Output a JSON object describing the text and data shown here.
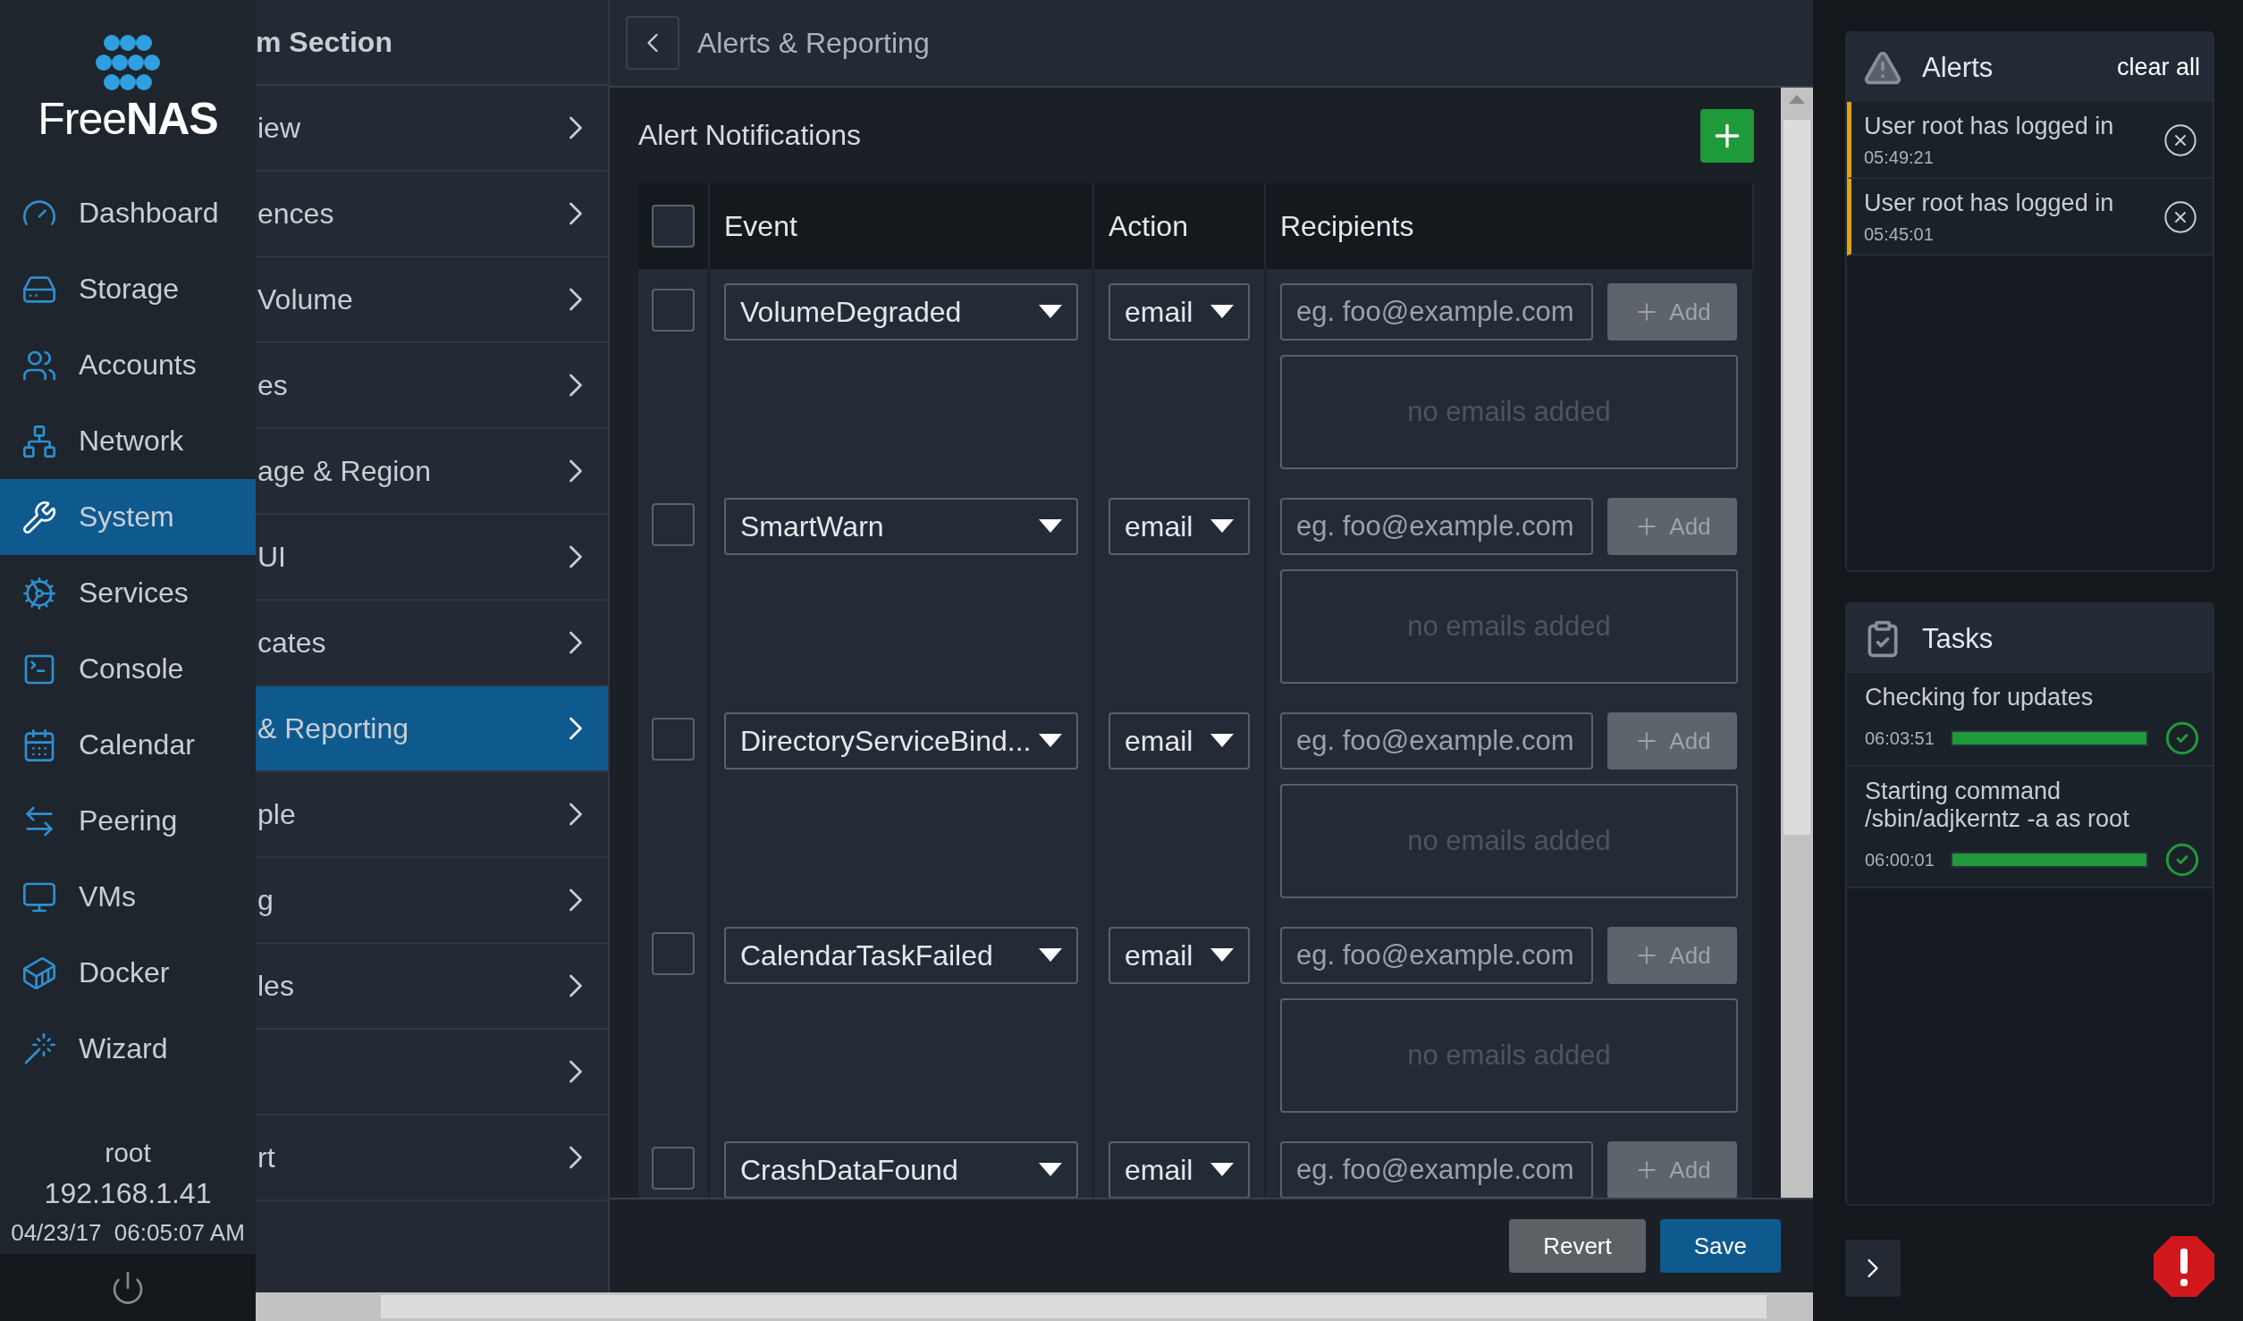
{
  "sidebar": {
    "logo": "Free**NAS**",
    "items": [
      {
        "label": "Dashboard",
        "selected": false
      },
      {
        "label": "Storage",
        "selected": false
      },
      {
        "label": "Accounts",
        "selected": false
      },
      {
        "label": "Network",
        "selected": false
      },
      {
        "label": "System",
        "selected": true
      },
      {
        "label": "Services",
        "selected": false
      },
      {
        "label": "Console",
        "selected": false
      },
      {
        "label": "Calendar",
        "selected": false
      },
      {
        "label": "Peering",
        "selected": false
      },
      {
        "label": "VMs",
        "selected": false
      },
      {
        "label": "Docker",
        "selected": false
      },
      {
        "label": "Wizard",
        "selected": false
      }
    ],
    "user": "root",
    "ip": "192.168.1.41",
    "datetime": "04/23/17  06:05:07 AM"
  },
  "submenu": {
    "title": "m Section",
    "items": [
      {
        "label": "iew",
        "selected": false
      },
      {
        "label": "ences",
        "selected": false
      },
      {
        "label": "Volume",
        "selected": false
      },
      {
        "label": "es",
        "selected": false
      },
      {
        "label": "age & Region",
        "selected": false
      },
      {
        "label": "UI",
        "selected": false
      },
      {
        "label": "cates",
        "selected": false
      },
      {
        "label": "& Reporting",
        "selected": true
      },
      {
        "label": "ple",
        "selected": false
      },
      {
        "label": "g",
        "selected": false
      },
      {
        "label": "les",
        "selected": false
      },
      {
        "selected": false
      },
      {
        "label": "rt",
        "selected": false
      }
    ]
  },
  "main": {
    "breadcrumb": "Alerts & Reporting",
    "section_title": "Alert Notifications",
    "table": {
      "columns": [
        "Event",
        "Action",
        "Recipients"
      ],
      "header_checked": false,
      "rows": [
        {
          "checked": false,
          "event": "VolumeDegraded",
          "action": "email",
          "placeholder": "eg. foo@example.com",
          "add": "Add",
          "empty": "no emails added"
        },
        {
          "checked": false,
          "event": "SmartWarn",
          "action": "email",
          "placeholder": "eg. foo@example.com",
          "add": "Add",
          "empty": "no emails added"
        },
        {
          "checked": false,
          "event": "DirectoryServiceBind...",
          "action": "email",
          "placeholder": "eg. foo@example.com",
          "add": "Add",
          "empty": "no emails added"
        },
        {
          "checked": false,
          "event": "CalendarTaskFailed",
          "action": "email",
          "placeholder": "eg. foo@example.com",
          "add": "Add",
          "empty": "no emails added"
        },
        {
          "checked": false,
          "event": "CrashDataFound",
          "action": "email",
          "placeholder": "eg. foo@example.com",
          "add": "Add"
        }
      ]
    },
    "buttons": [
      {
        "label": "Revert",
        "kind": "secondary"
      },
      {
        "label": "Save",
        "kind": "primary"
      }
    ]
  },
  "alerts": {
    "title": "Alerts",
    "clear": "clear all",
    "items": [
      {
        "message": "User root has logged in",
        "time": "05:49:21"
      },
      {
        "message": "User root has logged in",
        "time": "05:45:01"
      }
    ]
  },
  "tasks": {
    "title": "Tasks",
    "items": [
      {
        "message": "Checking for updates",
        "time": "06:03:51",
        "level": 1
      },
      {
        "message": "Starting command /sbin/adjkerntz -a as root",
        "time": "06:00:01",
        "level": 1
      }
    ]
  }
}
